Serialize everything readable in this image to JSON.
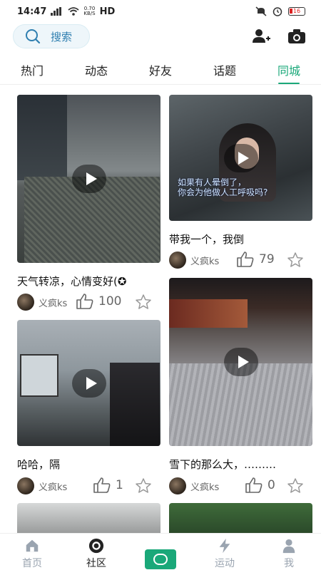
{
  "status_bar": {
    "time": "14:47",
    "network_speed_top": "0.70",
    "network_speed_bottom": "KB/S",
    "hd": "HD",
    "battery": "16"
  },
  "header": {
    "search_label": "搜索",
    "search_icon": "search-icon",
    "add_user_icon": "add-user-icon",
    "camera_icon": "camera-icon"
  },
  "tabs": [
    {
      "label": "热门",
      "active": false
    },
    {
      "label": "动态",
      "active": false
    },
    {
      "label": "好友",
      "active": false
    },
    {
      "label": "话题",
      "active": false
    },
    {
      "label": "同城",
      "active": true
    }
  ],
  "feed": {
    "left": [
      {
        "caption": "天气转凉，心情变好(✪",
        "author": "义疯ks",
        "likes": "100"
      },
      {
        "caption": "哈哈，隔",
        "author": "义疯ks",
        "likes": "1"
      }
    ],
    "right": [
      {
        "caption": "带我一个，我倒",
        "author": "义疯ks",
        "likes": "79",
        "overlay_line1": "如果有人晕倒了，",
        "overlay_line2": "你会为他做人工呼吸吗?"
      },
      {
        "caption": "雪下的那么大，………",
        "author": "义疯ks",
        "likes": "0"
      }
    ]
  },
  "bottom_nav": [
    {
      "label": "首页",
      "icon": "home-icon",
      "active": false
    },
    {
      "label": "社区",
      "icon": "community-icon",
      "active": true
    },
    {
      "label": "",
      "icon": "create-icon",
      "active": false
    },
    {
      "label": "运动",
      "icon": "lightning-icon",
      "active": false
    },
    {
      "label": "我",
      "icon": "profile-icon",
      "active": false
    }
  ],
  "colors": {
    "accent": "#1aa879",
    "search_text": "#2f7fb0"
  }
}
